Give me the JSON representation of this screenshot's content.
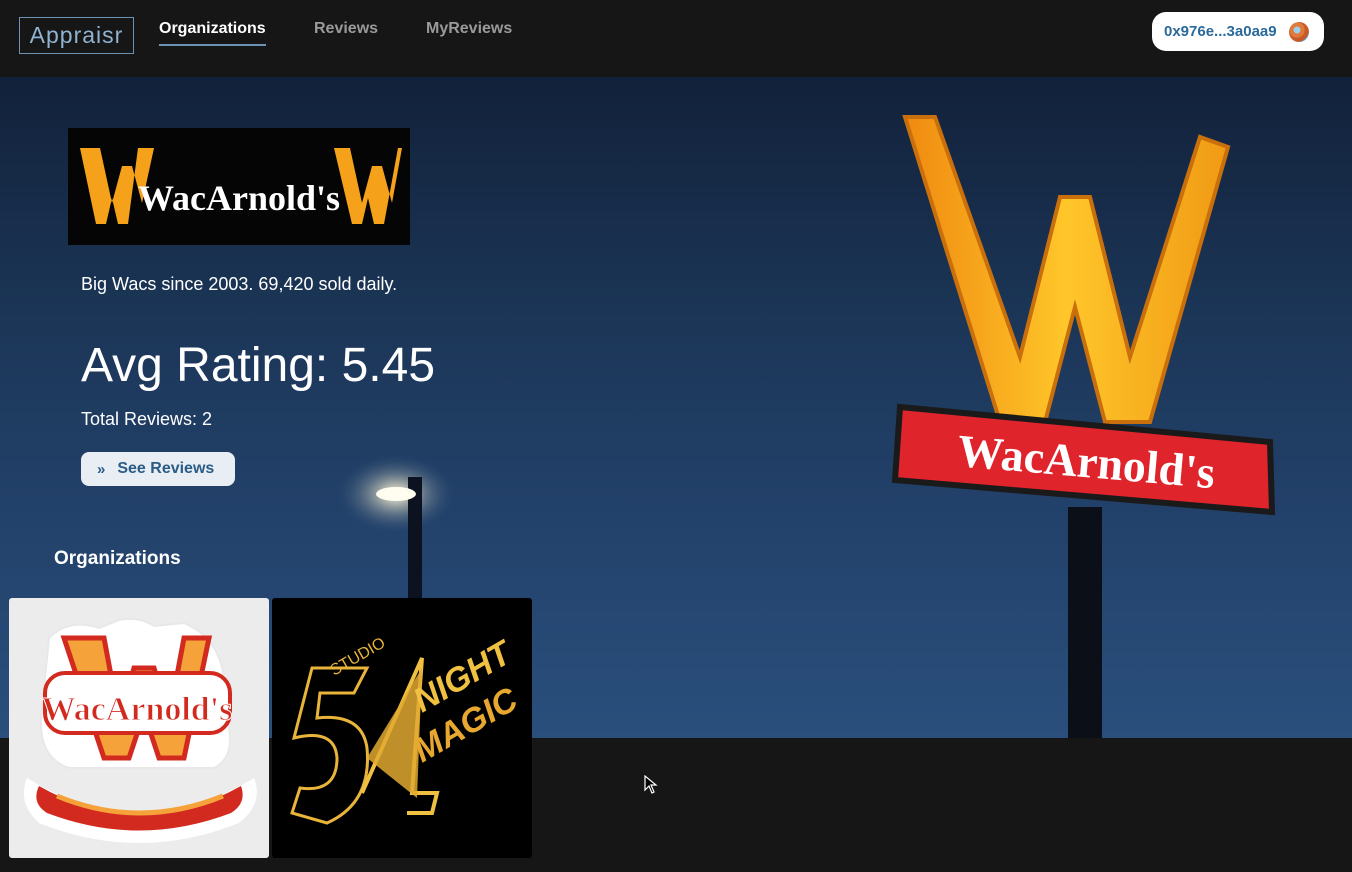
{
  "app": {
    "logo": "Appraisr",
    "nav": [
      {
        "label": "Organizations",
        "active": true
      },
      {
        "label": "Reviews",
        "active": false
      },
      {
        "label": "MyReviews",
        "active": false
      }
    ],
    "wallet": {
      "address": "0x976e...3a0aa9",
      "avatar_icon": "wallet-avatar-icon"
    }
  },
  "hero": {
    "brand_logo_text": "WacArnold's",
    "sign_text": "WacArnold's",
    "description": "Big Wacs since 2003. 69,420 sold daily.",
    "avg_rating": "Avg Rating: 5.45",
    "total_reviews": "Total Reviews: 2",
    "see_reviews_label": "See Reviews",
    "see_reviews_icon": "double-chevron-right-icon"
  },
  "organizations": {
    "title": "Organizations",
    "items": [
      {
        "name": "WacArnold's",
        "logo_text": "WacArnold's"
      },
      {
        "name": "Studio 54 Night Magic",
        "logo_text_top": "STUDIO",
        "logo_text_a": "NIGHT",
        "logo_text_b": "MAGIC"
      }
    ]
  },
  "colors": {
    "accent": "#6c93b4",
    "button_text": "#2a5c86",
    "sign_red": "#e0242c",
    "arch_orange": "#f5a21a"
  }
}
